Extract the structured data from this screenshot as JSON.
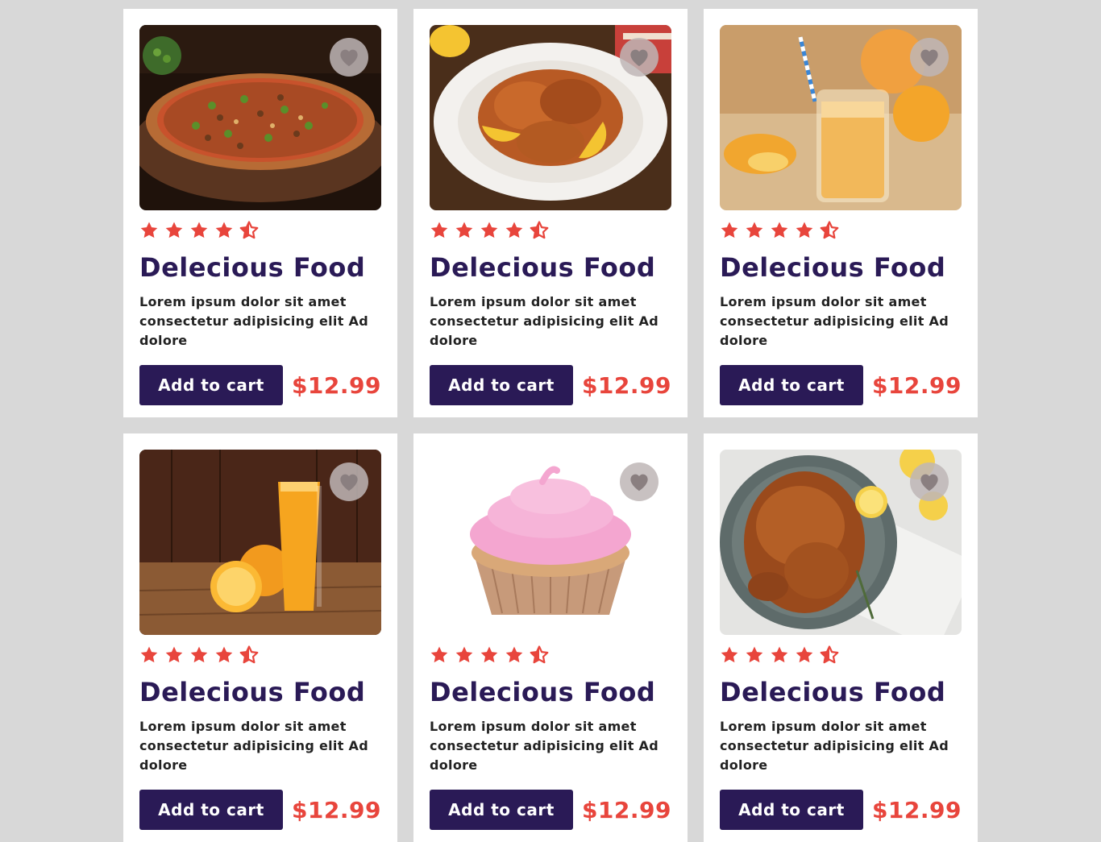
{
  "colors": {
    "background": "#d8d8d8",
    "card": "#ffffff",
    "primary": "#2a1a56",
    "accent": "#e8453c",
    "heart_bg": "#beb6b6"
  },
  "cards": [
    {
      "image": "pizza",
      "rating": 4.5,
      "title": "Delecious Food",
      "desc": "Lorem ipsum dolor sit amet consectetur adipisicing elit Ad dolore",
      "button": "Add to cart",
      "price": "$12.99",
      "favorite_icon": "heart-icon"
    },
    {
      "image": "grilled-chicken-plate",
      "rating": 4.5,
      "title": "Delecious Food",
      "desc": "Lorem ipsum dolor sit amet consectetur adipisicing elit Ad dolore",
      "button": "Add to cart",
      "price": "$12.99",
      "favorite_icon": "heart-icon"
    },
    {
      "image": "orange-juice-glass",
      "rating": 4.5,
      "title": "Delecious Food",
      "desc": "Lorem ipsum dolor sit amet consectetur adipisicing elit Ad dolore",
      "button": "Add to cart",
      "price": "$12.99",
      "favorite_icon": "heart-icon"
    },
    {
      "image": "orange-juice-wood",
      "rating": 4.5,
      "title": "Delecious Food",
      "desc": "Lorem ipsum dolor sit amet consectetur adipisicing elit Ad dolore",
      "button": "Add to cart",
      "price": "$12.99",
      "favorite_icon": "heart-icon"
    },
    {
      "image": "cupcake",
      "rating": 4.5,
      "title": "Delecious Food",
      "desc": "Lorem ipsum dolor sit amet consectetur adipisicing elit Ad dolore",
      "button": "Add to cart",
      "price": "$12.99",
      "favorite_icon": "heart-icon"
    },
    {
      "image": "roast-chicken",
      "rating": 4.5,
      "title": "Delecious Food",
      "desc": "Lorem ipsum dolor sit amet consectetur adipisicing elit Ad dolore",
      "button": "Add to cart",
      "price": "$12.99",
      "favorite_icon": "heart-icon"
    }
  ]
}
